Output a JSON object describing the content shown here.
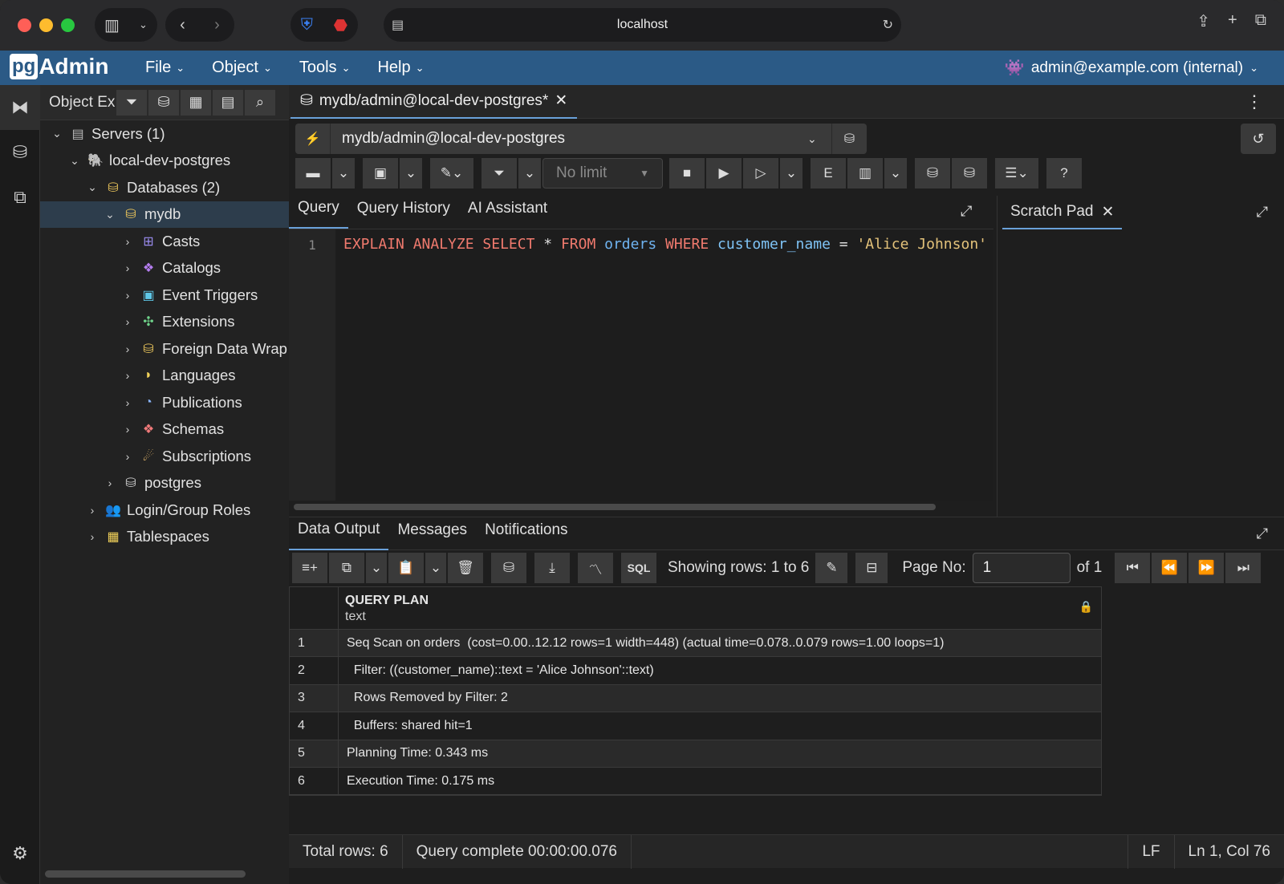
{
  "browser": {
    "url": "localhost"
  },
  "menubar": {
    "logo_pg": "pg",
    "logo_admin": "Admin",
    "items": [
      "File",
      "Object",
      "Tools",
      "Help"
    ],
    "user": "admin@example.com (internal)"
  },
  "explorer": {
    "title": "Object Explorer",
    "tree": [
      {
        "label": "Servers (1)",
        "indent": 0,
        "expanded": true,
        "icon": "servers-icon"
      },
      {
        "label": "local-dev-postgres",
        "indent": 1,
        "expanded": true,
        "icon": "elephant-icon"
      },
      {
        "label": "Databases (2)",
        "indent": 2,
        "expanded": true,
        "icon": "databases-icon"
      },
      {
        "label": "mydb",
        "indent": 3,
        "expanded": true,
        "icon": "database-icon",
        "selected": true
      },
      {
        "label": "Casts",
        "indent": 4,
        "icon": "casts-icon"
      },
      {
        "label": "Catalogs",
        "indent": 4,
        "icon": "catalogs-icon"
      },
      {
        "label": "Event Triggers",
        "indent": 4,
        "icon": "event-triggers-icon"
      },
      {
        "label": "Extensions",
        "indent": 4,
        "icon": "extensions-icon"
      },
      {
        "label": "Foreign Data Wrap",
        "indent": 4,
        "icon": "foreign-data-wrapper-icon"
      },
      {
        "label": "Languages",
        "indent": 4,
        "icon": "languages-icon"
      },
      {
        "label": "Publications",
        "indent": 4,
        "icon": "publications-icon"
      },
      {
        "label": "Schemas",
        "indent": 4,
        "icon": "schemas-icon"
      },
      {
        "label": "Subscriptions",
        "indent": 4,
        "icon": "subscriptions-icon"
      },
      {
        "label": "postgres",
        "indent": 3,
        "icon": "database-disconnected-icon"
      },
      {
        "label": "Login/Group Roles",
        "indent": 2,
        "icon": "roles-icon"
      },
      {
        "label": "Tablespaces",
        "indent": 2,
        "icon": "tablespaces-icon"
      }
    ]
  },
  "main": {
    "tab_title": "mydb/admin@local-dev-postgres*",
    "connection": "mydb/admin@local-dev-postgres",
    "no_limit": "No limit",
    "query_tabs": [
      "Query",
      "Query History",
      "AI Assistant"
    ],
    "line_number": "1",
    "sql": {
      "kw1": "EXPLAIN ANALYZE SELECT",
      "star": " * ",
      "kw2": "FROM",
      "table": " orders ",
      "kw3": "WHERE",
      "column": " customer_name ",
      "eq": "= ",
      "str": "'Alice Johnson'"
    },
    "scratch_pad": "Scratch Pad",
    "result_tabs": [
      "Data Output",
      "Messages",
      "Notifications"
    ],
    "showing_rows": "Showing rows: 1 to 6",
    "page_label": "Page No:",
    "page_value": "1",
    "page_of": "of 1",
    "columns": {
      "name": "QUERY PLAN",
      "type": "text"
    },
    "rows": [
      {
        "n": "1",
        "v": "Seq Scan on orders  (cost=0.00..12.12 rows=1 width=448) (actual time=0.078..0.079 rows=1.00 loops=1)"
      },
      {
        "n": "2",
        "v": "  Filter: ((customer_name)::text = 'Alice Johnson'::text)"
      },
      {
        "n": "3",
        "v": "  Rows Removed by Filter: 2"
      },
      {
        "n": "4",
        "v": "  Buffers: shared hit=1"
      },
      {
        "n": "5",
        "v": "Planning Time: 0.343 ms"
      },
      {
        "n": "6",
        "v": "Execution Time: 0.175 ms"
      }
    ],
    "status": {
      "total": "Total rows: 6",
      "complete": "Query complete 00:00:00.076",
      "eol": "LF",
      "pos": "Ln 1, Col 76"
    }
  }
}
